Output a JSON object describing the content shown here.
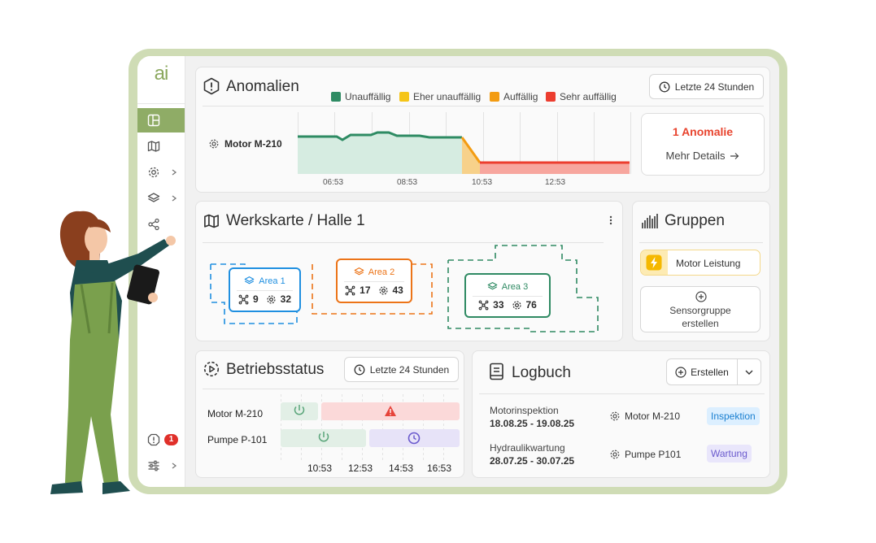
{
  "app": {
    "logo": "ai"
  },
  "sidebar": {
    "items": [
      {
        "icon": "layout-icon",
        "active": true
      },
      {
        "icon": "map-icon",
        "active": false
      },
      {
        "icon": "gear-icon",
        "active": false,
        "has_chevron": true
      },
      {
        "icon": "layers-icon",
        "active": false,
        "has_chevron": true
      },
      {
        "icon": "share-icon",
        "active": false
      }
    ],
    "bottom": {
      "alert_count": "1"
    }
  },
  "anomalies": {
    "title": "Anomalien",
    "legend": [
      {
        "label": "Unauffällig",
        "color": "#2e8b63"
      },
      {
        "label": "Eher unauffällig",
        "color": "#f5c518"
      },
      {
        "label": "Auffällig",
        "color": "#f39c12"
      },
      {
        "label": "Sehr auffällig",
        "color": "#ec3d2f"
      }
    ],
    "time_button": "Letzte 24 Stunden",
    "device": "Motor M-210",
    "x_ticks": [
      "06:53",
      "08:53",
      "10:53",
      "12:53"
    ],
    "summary_count": "1 Anomalie",
    "details_link": "Mehr Details"
  },
  "werkskarte": {
    "title": "Werkskarte / Halle 1",
    "areas": [
      {
        "name": "Area 1",
        "color": "#1f8fe0",
        "sensors": "9",
        "devices": "32"
      },
      {
        "name": "Area 2",
        "color": "#ec7418",
        "sensors": "17",
        "devices": "43"
      },
      {
        "name": "Area 3",
        "color": "#2f8a63",
        "sensors": "33",
        "devices": "76"
      }
    ]
  },
  "gruppen": {
    "title": "Gruppen",
    "item": "Motor Leistung",
    "create_label_1": "Sensorgruppe",
    "create_label_2": "erstellen"
  },
  "betriebsstatus": {
    "title": "Betriebsstatus",
    "time_button": "Letzte 24 Stunden",
    "rows": [
      "Motor M-210",
      "Pumpe P-101"
    ],
    "x_ticks": [
      "10:53",
      "12:53",
      "14:53",
      "16:53"
    ]
  },
  "logbuch": {
    "title": "Logbuch",
    "create_button": "Erstellen",
    "entries": [
      {
        "title": "Motorinspektion",
        "dates": "18.08.25 - 19.08.25",
        "device": "Motor M-210",
        "tag": "Inspektion",
        "tag_bg": "#dcefff",
        "tag_fg": "#1a7fd0"
      },
      {
        "title": "Hydraulikwartung",
        "dates": "28.07.25 - 30.07.25",
        "device": "Pumpe P101",
        "tag": "Wartung",
        "tag_bg": "#e9e6fb",
        "tag_fg": "#6a5acd"
      }
    ]
  }
}
